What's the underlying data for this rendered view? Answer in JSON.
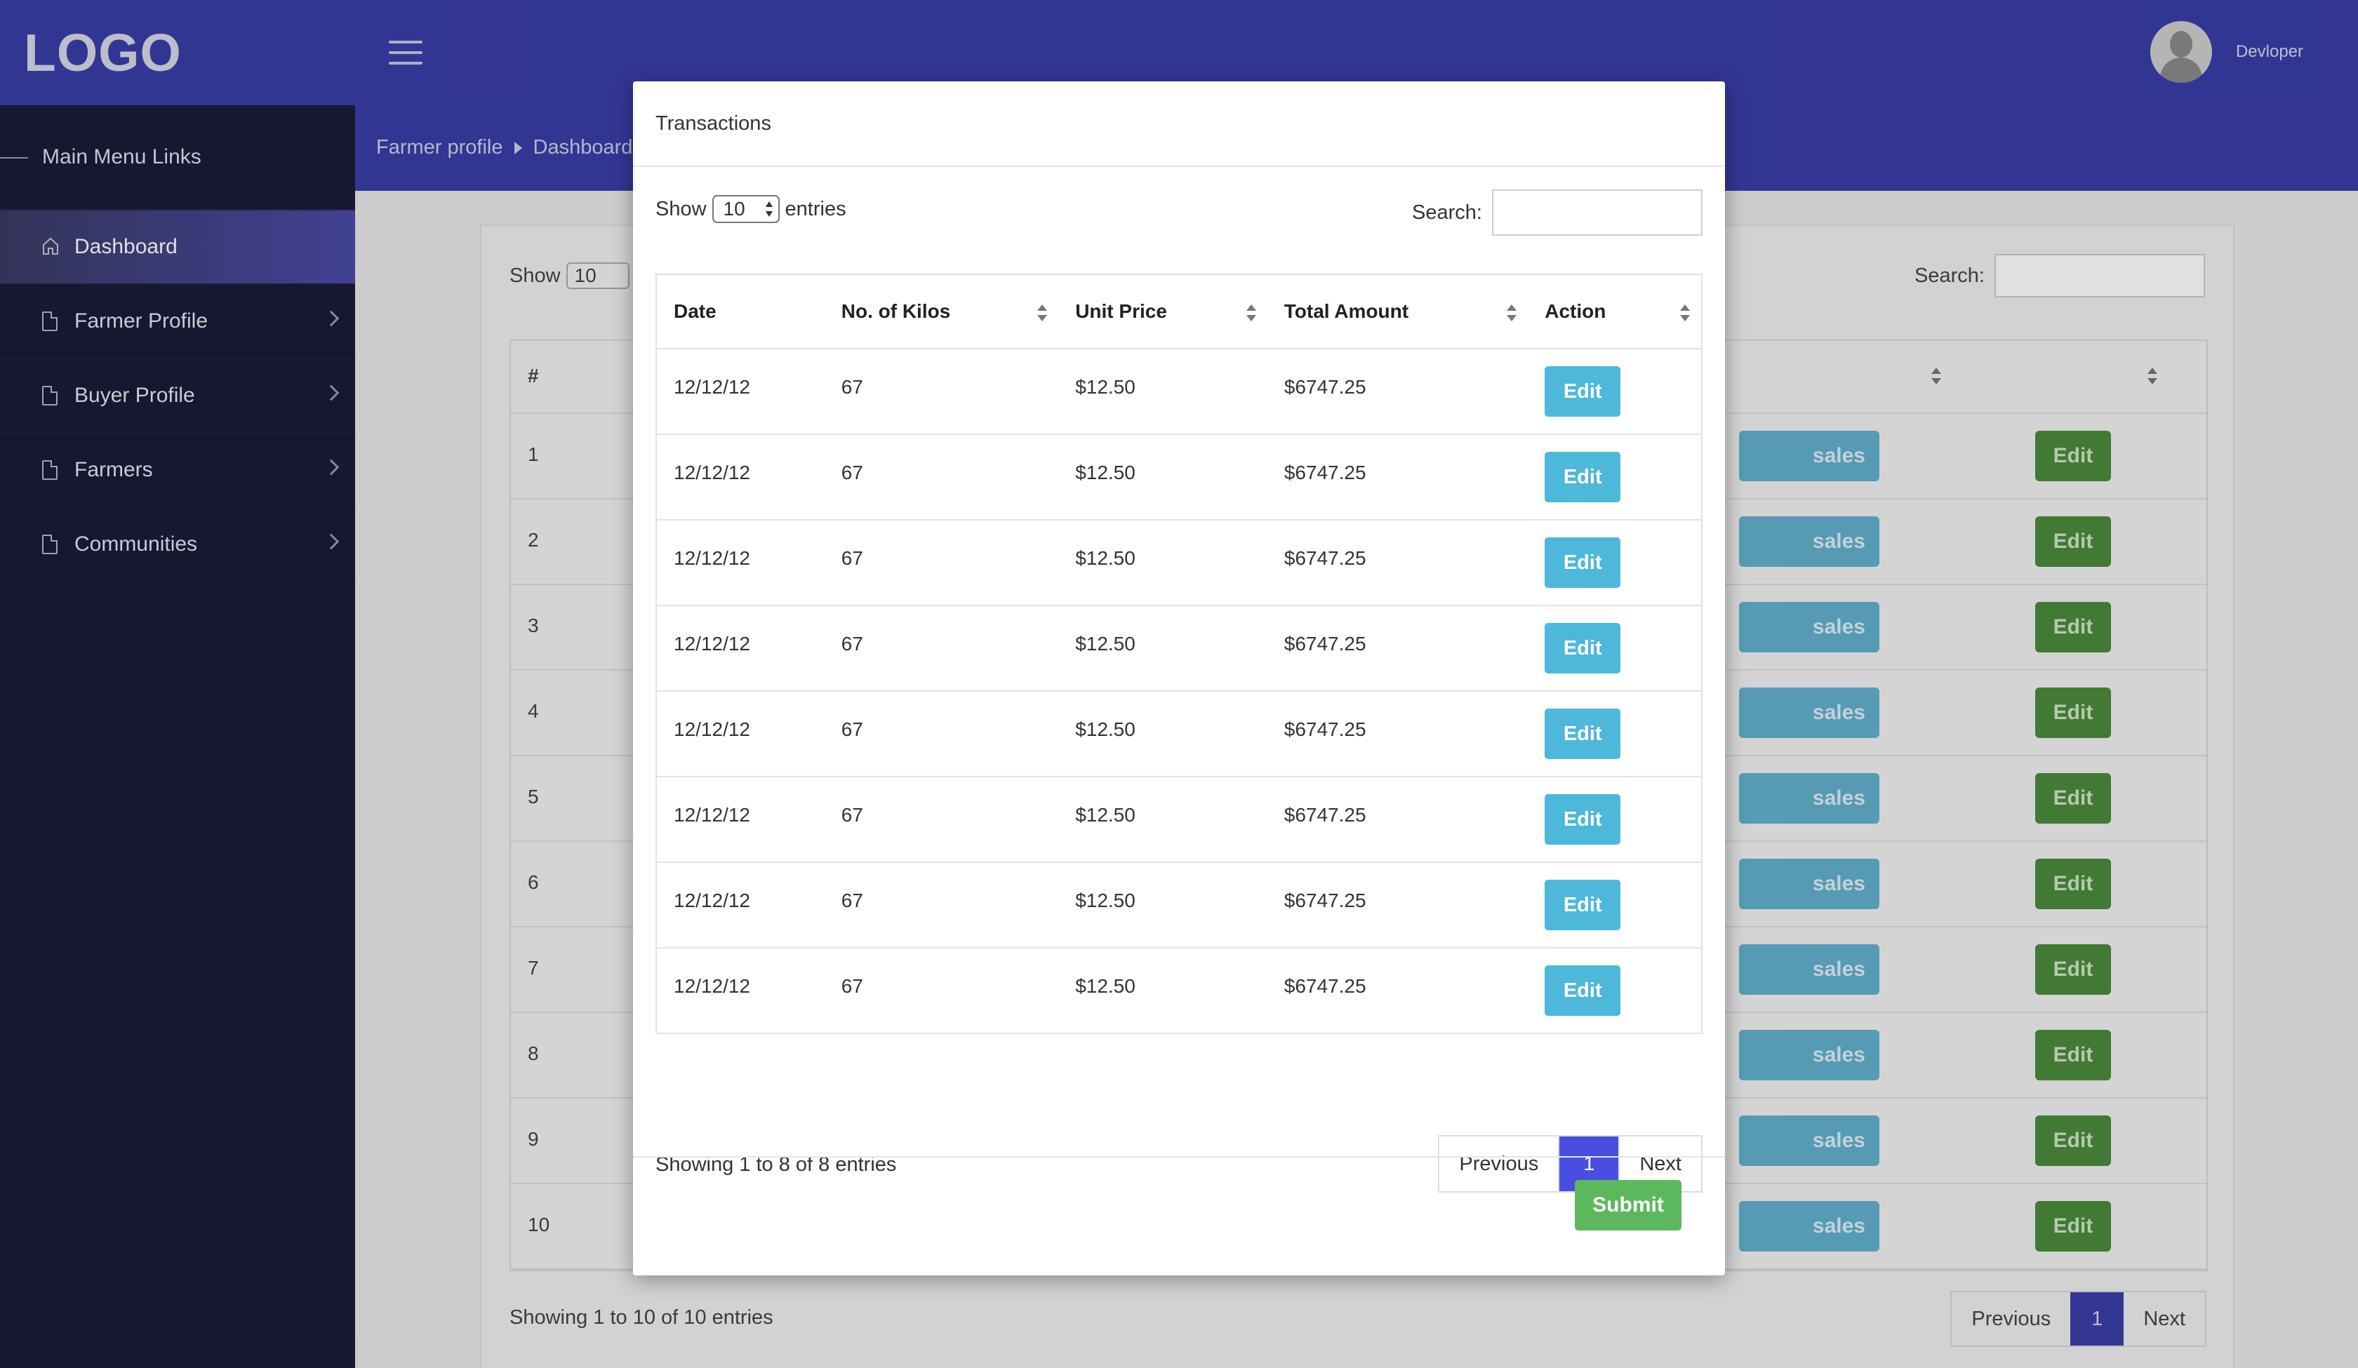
{
  "app": {
    "logo": "LOGO"
  },
  "sidebar": {
    "heading": "Main Menu Links",
    "items": [
      {
        "label": "Dashboard",
        "icon": "home-icon",
        "active": true
      },
      {
        "label": "Farmer Profile",
        "icon": "document-icon"
      },
      {
        "label": "Buyer Profile",
        "icon": "document-icon"
      },
      {
        "label": "Farmers",
        "icon": "document-icon"
      },
      {
        "label": "Communities",
        "icon": "document-icon"
      }
    ]
  },
  "header": {
    "breadcrumb": [
      "Farmer profile",
      "Dashboard"
    ],
    "user_name": "Devloper"
  },
  "background_table": {
    "show_label": "Show",
    "length_value": "10",
    "search_label": "Search:",
    "hash_header": "#",
    "rows": [
      "1",
      "2",
      "3",
      "4",
      "5",
      "6",
      "7",
      "8",
      "9",
      "10"
    ],
    "sales_label": "sales",
    "edit_label": "Edit",
    "info": "Showing 1 to 10 of 10 entries",
    "pager": {
      "previous": "Previous",
      "current": "1",
      "next": "Next"
    }
  },
  "modal": {
    "title": "Transactions",
    "show_label": "Show",
    "length_value": "10",
    "entries_label": "entries",
    "search_label": "Search:",
    "columns": [
      "Date",
      "No. of Kilos",
      "Unit Price",
      "Total Amount",
      "Action"
    ],
    "rows": [
      {
        "date": "12/12/12",
        "kilos": "67",
        "unit_price": "$12.50",
        "total": "$6747.25",
        "action": "Edit"
      },
      {
        "date": "12/12/12",
        "kilos": "67",
        "unit_price": "$12.50",
        "total": "$6747.25",
        "action": "Edit"
      },
      {
        "date": "12/12/12",
        "kilos": "67",
        "unit_price": "$12.50",
        "total": "$6747.25",
        "action": "Edit"
      },
      {
        "date": "12/12/12",
        "kilos": "67",
        "unit_price": "$12.50",
        "total": "$6747.25",
        "action": "Edit"
      },
      {
        "date": "12/12/12",
        "kilos": "67",
        "unit_price": "$12.50",
        "total": "$6747.25",
        "action": "Edit"
      },
      {
        "date": "12/12/12",
        "kilos": "67",
        "unit_price": "$12.50",
        "total": "$6747.25",
        "action": "Edit"
      },
      {
        "date": "12/12/12",
        "kilos": "67",
        "unit_price": "$12.50",
        "total": "$6747.25",
        "action": "Edit"
      },
      {
        "date": "12/12/12",
        "kilos": "67",
        "unit_price": "$12.50",
        "total": "$6747.25",
        "action": "Edit"
      }
    ],
    "info": "Showing 1 to 8 of 8 entries",
    "pager": {
      "previous": "Previous",
      "current": "1",
      "next": "Next"
    },
    "submit_label": "Submit"
  },
  "colors": {
    "sidebar_bg": "#1b1b3a",
    "topbar_bg": "#3a3ea8",
    "edit_btn": "#4db8d9",
    "submit_btn": "#5cb85c",
    "pager_active": "#4a4ee0"
  }
}
